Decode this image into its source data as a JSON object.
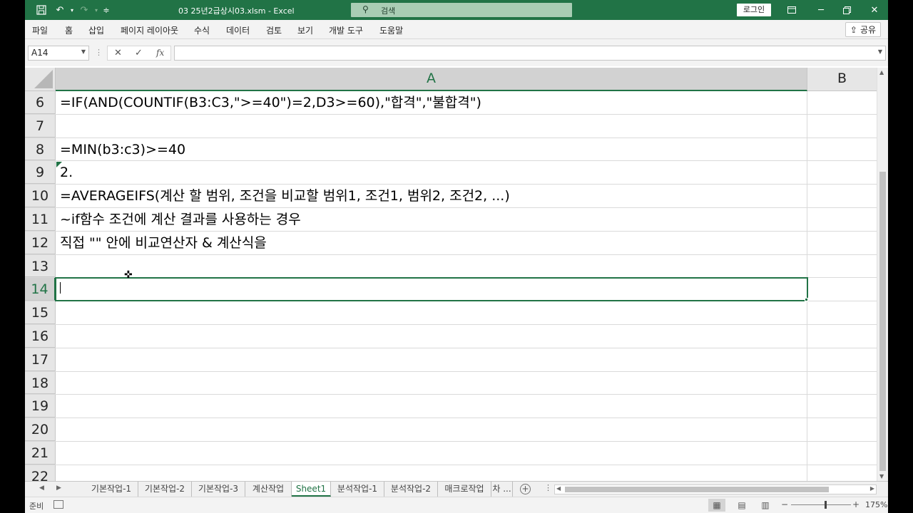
{
  "window": {
    "title": "03 25년2급상시03.xlsm  -  Excel",
    "search_label": "검색",
    "login_label": "로그인"
  },
  "menu": {
    "tabs": [
      "파일",
      "홈",
      "삽입",
      "페이지 레이아웃",
      "수식",
      "데이터",
      "검토",
      "보기",
      "개발 도구",
      "도움말"
    ],
    "share_label": "공유"
  },
  "formula_bar": {
    "name_box": "A14",
    "formula": "",
    "fx_label": "fx"
  },
  "grid": {
    "columns": [
      "A",
      "B"
    ],
    "active_cell": "A14",
    "rows": [
      {
        "num": "6",
        "a": "=IF(AND(COUNTIF(B3:C3,\">=40\")=2,D3>=60),\"합격\",\"불합격\")"
      },
      {
        "num": "7",
        "a": ""
      },
      {
        "num": "8",
        "a": "=MIN(b3:c3)>=40"
      },
      {
        "num": "9",
        "a": "2."
      },
      {
        "num": "10",
        "a": "=AVERAGEIFS(계산 할 범위, 조건을 비교할 범위1, 조건1, 범위2, 조건2, ...)"
      },
      {
        "num": "11",
        "a": "~if함수 조건에 계산 결과를 사용하는 경우"
      },
      {
        "num": "12",
        "a": "직접 \"\" 안에 비교연산자 & 계산식을"
      },
      {
        "num": "13",
        "a": ""
      },
      {
        "num": "14",
        "a": ""
      },
      {
        "num": "15",
        "a": ""
      },
      {
        "num": "16",
        "a": ""
      },
      {
        "num": "17",
        "a": ""
      },
      {
        "num": "18",
        "a": ""
      },
      {
        "num": "19",
        "a": ""
      },
      {
        "num": "20",
        "a": ""
      },
      {
        "num": "21",
        "a": ""
      },
      {
        "num": "22",
        "a": ""
      }
    ]
  },
  "sheets": {
    "tabs": [
      "기본작업-1",
      "기본작업-2",
      "기본작업-3",
      "계산작업",
      "Sheet1",
      "분석작업-1",
      "분석작업-2",
      "매크로작업",
      "차 ..."
    ],
    "active": "Sheet1"
  },
  "status": {
    "ready_label": "준비",
    "zoom_level": "175%"
  },
  "colors": {
    "accent": "#217346",
    "search_bg": "#a9cdb4"
  }
}
